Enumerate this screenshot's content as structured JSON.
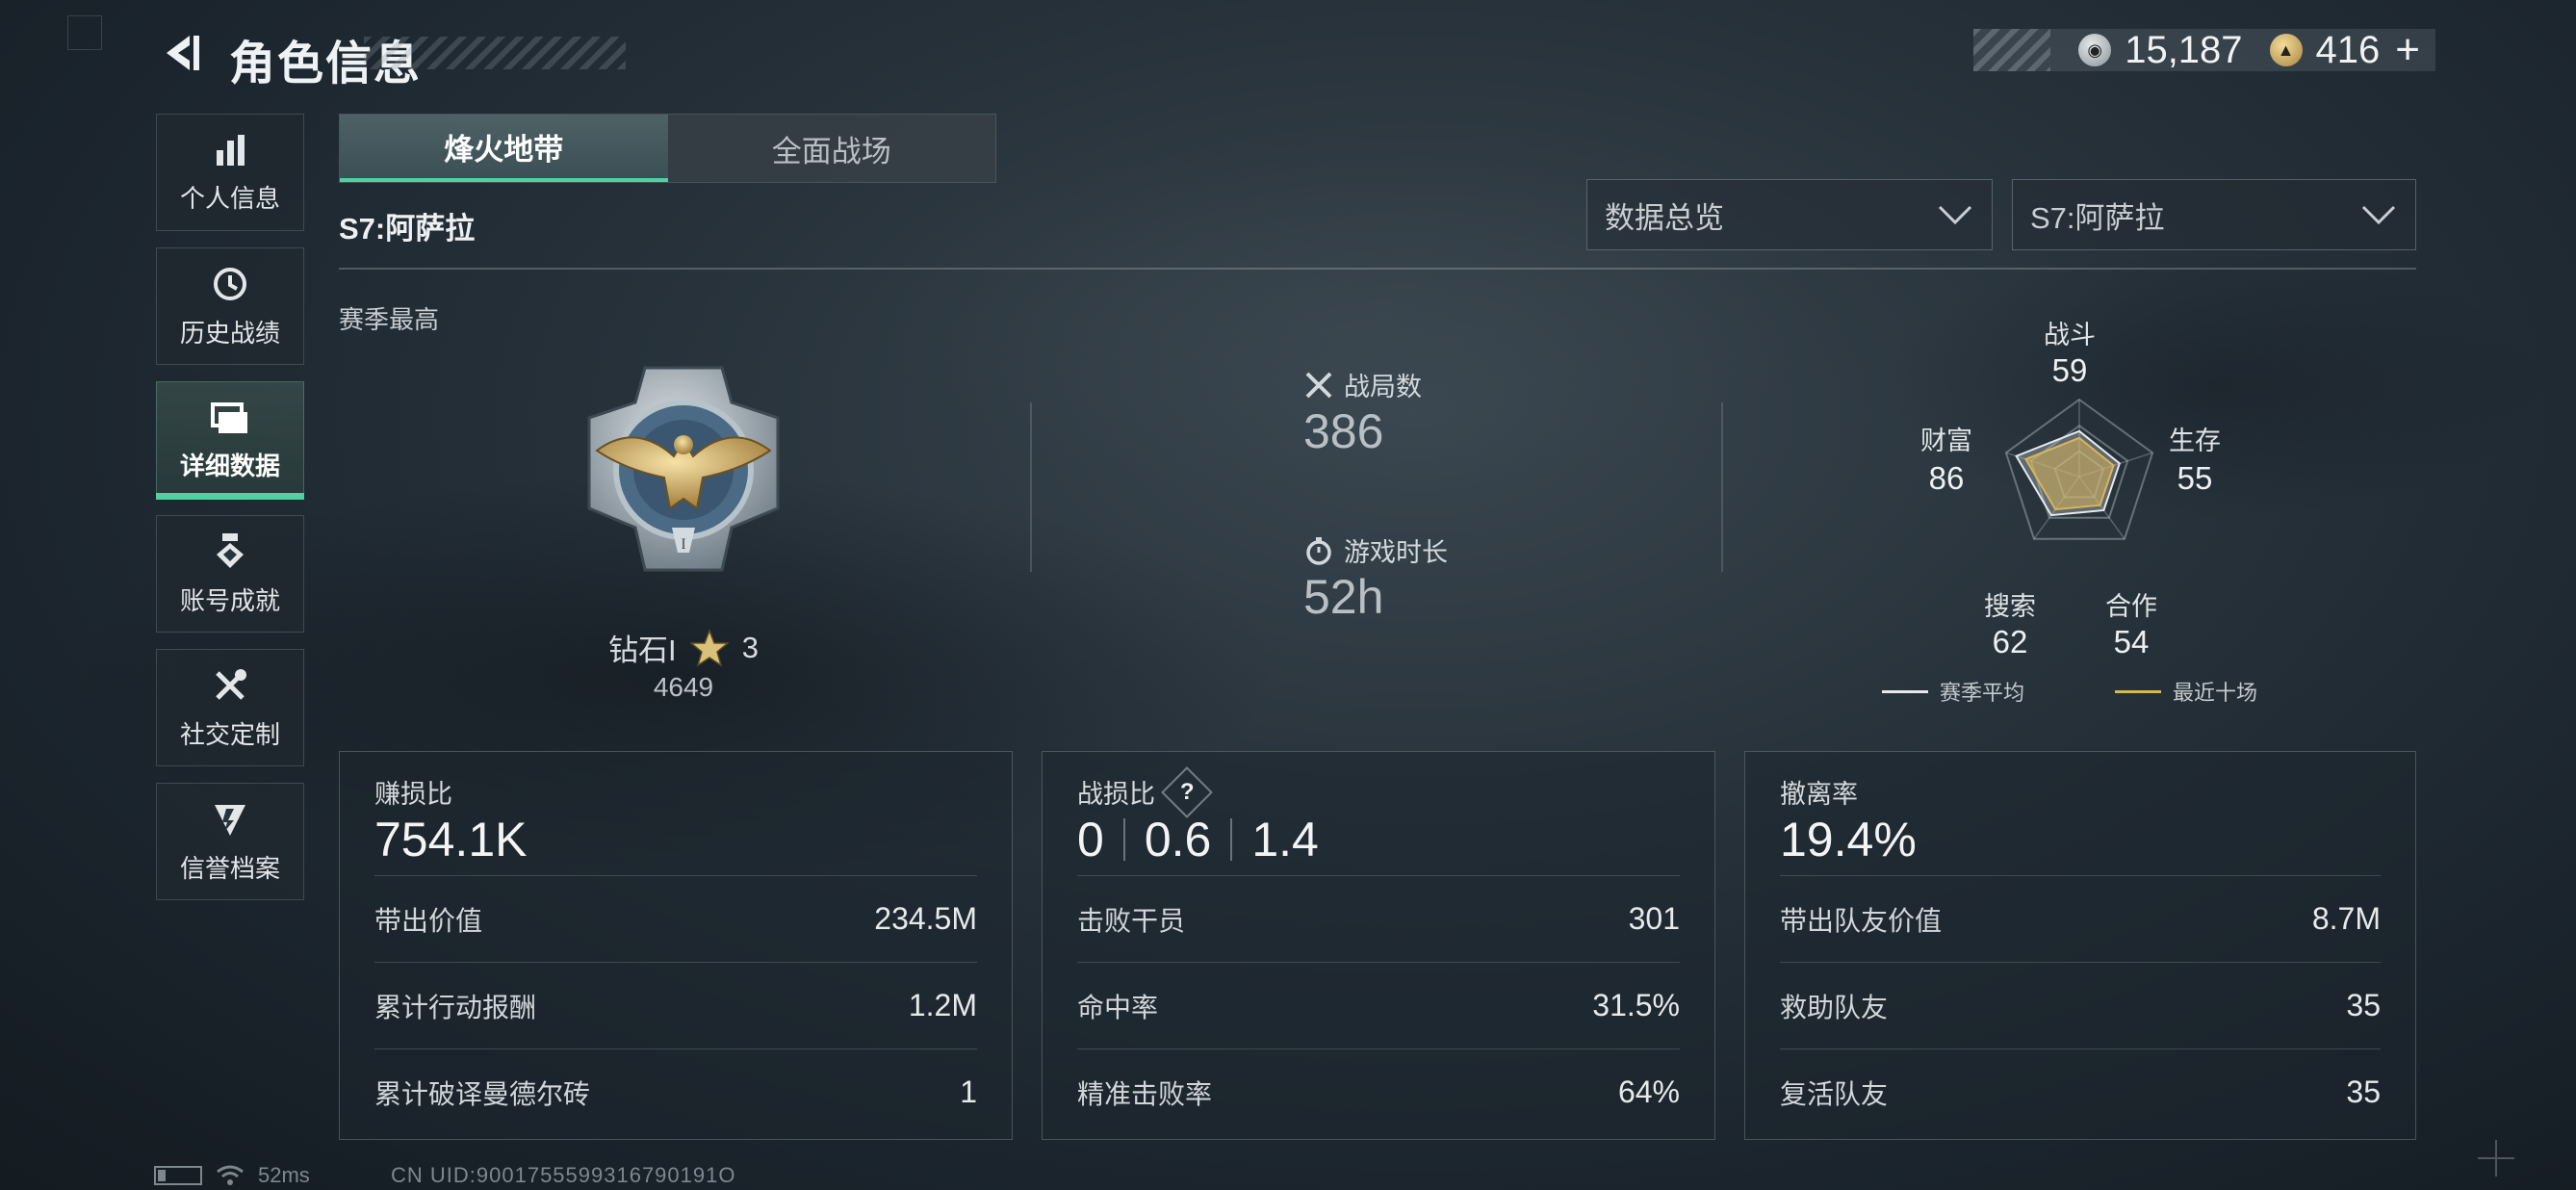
{
  "header": {
    "title": "角色信息",
    "currency_silver": "15,187",
    "currency_gold": "416",
    "add_symbol": "+"
  },
  "sidebar": {
    "items": [
      {
        "label": "个人信息",
        "icon": "bar-chart-icon"
      },
      {
        "label": "历史战绩",
        "icon": "history-icon"
      },
      {
        "label": "详细数据",
        "icon": "folder-icon",
        "active": true
      },
      {
        "label": "账号成就",
        "icon": "achievement-icon"
      },
      {
        "label": "社交定制",
        "icon": "tools-icon"
      },
      {
        "label": "信誉档案",
        "icon": "shield-icon"
      }
    ]
  },
  "tabs": [
    {
      "label": "烽火地带",
      "active": true
    },
    {
      "label": "全面战场",
      "active": false
    }
  ],
  "season": {
    "title": "S7:阿萨拉",
    "best_label": "赛季最高",
    "rank_name": "钻石I",
    "rank_stars": "3",
    "rank_score": "4649"
  },
  "filters": {
    "view": "数据总览",
    "season": "S7:阿萨拉"
  },
  "overview": {
    "matches_label": "战局数",
    "matches_value": "386",
    "playtime_label": "游戏时长",
    "playtime_value": "52h"
  },
  "radar": {
    "axes": [
      {
        "label": "战斗",
        "value": "59"
      },
      {
        "label": "生存",
        "value": "55"
      },
      {
        "label": "合作",
        "value": "54"
      },
      {
        "label": "搜索",
        "value": "62"
      },
      {
        "label": "财富",
        "value": "86"
      }
    ],
    "legend_season": "赛季平均",
    "legend_recent": "最近十场",
    "colors": {
      "season": "#e6eaec",
      "recent": "#d9b45a"
    }
  },
  "cards": {
    "profit": {
      "title": "赚损比",
      "big": "754.1K",
      "rows": [
        {
          "k": "带出价值",
          "v": "234.5M"
        },
        {
          "k": "累计行动报酬",
          "v": "1.2M"
        },
        {
          "k": "累计破译曼德尔砖",
          "v": "1"
        }
      ]
    },
    "combat": {
      "title": "战损比",
      "help": "?",
      "big_parts": [
        "0",
        "0.6",
        "1.4"
      ],
      "rows": [
        {
          "k": "击败干员",
          "v": "301"
        },
        {
          "k": "命中率",
          "v": "31.5%"
        },
        {
          "k": "精准击败率",
          "v": "64%"
        }
      ]
    },
    "extract": {
      "title": "撤离率",
      "big": "19.4%",
      "rows": [
        {
          "k": "带出队友价值",
          "v": "8.7M"
        },
        {
          "k": "救助队友",
          "v": "35"
        },
        {
          "k": "复活队友",
          "v": "35"
        }
      ]
    }
  },
  "status": {
    "ping": "52ms",
    "uid": "CN UID:9001755599316790191O"
  },
  "accent_color": "#4fd1a0"
}
